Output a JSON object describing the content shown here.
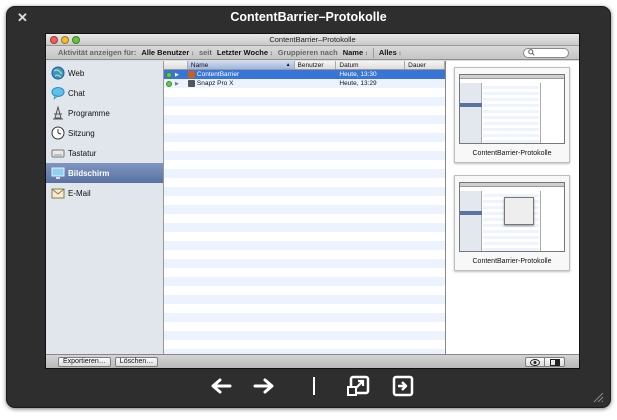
{
  "quicklook": {
    "title": "ContentBarrier–Protokolle",
    "close_glyph": "✕"
  },
  "window": {
    "title": "ContentBarrier–Protokolle",
    "traffic_lights": [
      "#ee5f57",
      "#f5bb2f",
      "#63c63f"
    ]
  },
  "toolbar": {
    "activity_label": "Aktivität anzeigen für:",
    "users_value": "Alle Benutzer",
    "since_label": "seit",
    "period_value": "Letzter Woche",
    "group_label": "Gruppieren nach",
    "group_value": "Name",
    "filter_value": "Alles",
    "search_icon": "search-icon"
  },
  "sidebar": {
    "items": [
      {
        "label": "Web",
        "icon": "globe-icon",
        "selected": false
      },
      {
        "label": "Chat",
        "icon": "speech-bubble-icon",
        "selected": false
      },
      {
        "label": "Programme",
        "icon": "applications-icon",
        "selected": false
      },
      {
        "label": "Sitzung",
        "icon": "clock-icon",
        "selected": false
      },
      {
        "label": "Tastatur",
        "icon": "keyboard-icon",
        "selected": false
      },
      {
        "label": "Bildschirm",
        "icon": "screen-icon",
        "selected": true
      },
      {
        "label": "E-Mail",
        "icon": "envelope-icon",
        "selected": false
      }
    ]
  },
  "list": {
    "headers": {
      "name": "Name",
      "user": "Benutzer",
      "date": "Datum",
      "duration": "Dauer"
    },
    "rows": [
      {
        "name": "ContentBarrier",
        "user": "",
        "date": "Heute, 13:30",
        "duration": "",
        "selected": true,
        "icon_color": "#c9611c"
      },
      {
        "name": "Snapz Pro X",
        "user": "",
        "date": "Heute, 13:29",
        "duration": "",
        "selected": false,
        "icon_color": "#555555"
      }
    ]
  },
  "preview": {
    "thumbs": [
      {
        "caption": "ContentBarrier-Protokolle"
      },
      {
        "caption": "ContentBarrier-Protokolle"
      }
    ]
  },
  "bottom": {
    "export_label": "Exportieren…",
    "delete_label": "Löschen…"
  },
  "colors": {
    "selection": "#3875d7",
    "sidebar_selection": "#5a72a3",
    "panel": "#2e2e2e"
  }
}
